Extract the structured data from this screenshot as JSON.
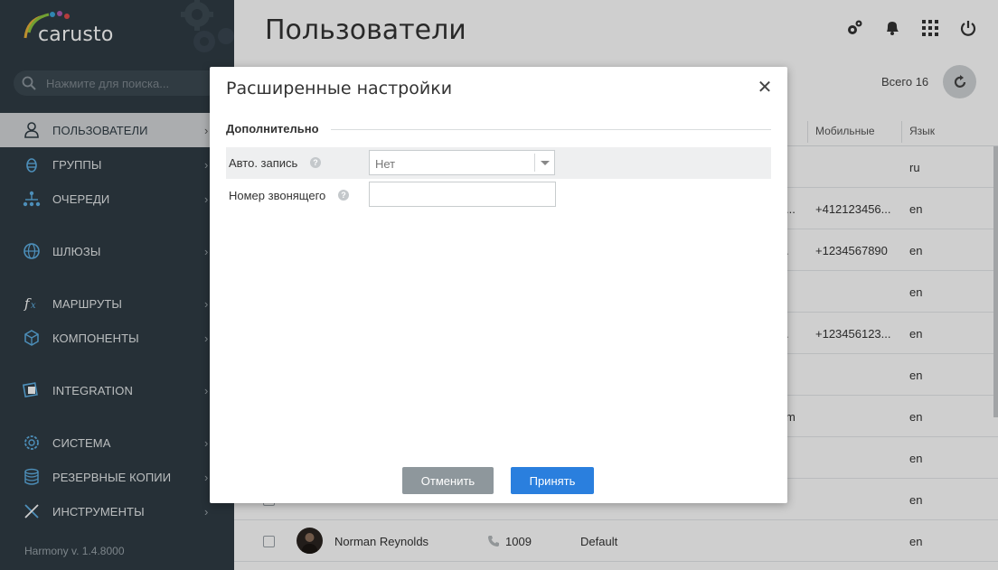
{
  "sidebar": {
    "logo_text": "carusto",
    "search_placeholder": "Нажмите для поиска...",
    "items": [
      {
        "label": "ПОЛЬЗОВАТЕЛИ",
        "icon": "user-icon"
      },
      {
        "label": "ГРУППЫ",
        "icon": "group-icon"
      },
      {
        "label": "ОЧЕРЕДИ",
        "icon": "queue-icon"
      },
      {
        "label": "ШЛЮЗЫ",
        "icon": "globe-icon"
      },
      {
        "label": "МАРШРУТЫ",
        "icon": "function-icon"
      },
      {
        "label": "КОМПОНЕНТЫ",
        "icon": "cube-icon"
      },
      {
        "label": "INTEGRATION",
        "icon": "integration-icon"
      },
      {
        "label": "СИСТЕМА",
        "icon": "system-gear-icon"
      },
      {
        "label": "РЕЗЕРВНЫЕ КОПИИ",
        "icon": "database-icon"
      },
      {
        "label": "ИНСТРУМЕНТЫ",
        "icon": "tools-icon"
      }
    ],
    "version": "Harmony v. 1.4.8000"
  },
  "header": {
    "title": "Пользователи",
    "total_label": "Всего 16"
  },
  "table": {
    "columns": {
      "mobile": "Мобильные",
      "language": "Язык"
    },
    "rows": [
      {
        "left_text": "",
        "mobile": "",
        "language": "ru"
      },
      {
        "left_text": "...",
        "mobile": "+412123456...",
        "language": "en"
      },
      {
        "left_text": ".",
        "mobile": "+1234567890",
        "language": "en"
      },
      {
        "left_text": "",
        "mobile": "",
        "language": "en"
      },
      {
        "left_text": ".",
        "mobile": "+123456123...",
        "language": "en"
      },
      {
        "left_text": "",
        "mobile": "",
        "language": "en"
      },
      {
        "left_text": "m",
        "mobile": "",
        "language": "en"
      },
      {
        "left_text": "",
        "mobile": "",
        "language": "en"
      },
      {
        "left_text": "",
        "mobile": "",
        "language": "en"
      }
    ],
    "last_row": {
      "name": "Norman Reynolds",
      "extension": "1009",
      "group": "Default",
      "language": "en"
    }
  },
  "modal": {
    "title": "Расширенные настройки",
    "section": "Дополнительно",
    "fields": {
      "auto_record_label": "Авто. запись",
      "auto_record_value": "Нет",
      "caller_id_label": "Номер звонящего",
      "caller_id_value": ""
    },
    "cancel_label": "Отменить",
    "accept_label": "Принять"
  },
  "colors": {
    "sidebar_bg": "#2f3c44",
    "accent": "#2a7fde",
    "cancel_btn": "#8e979c"
  }
}
